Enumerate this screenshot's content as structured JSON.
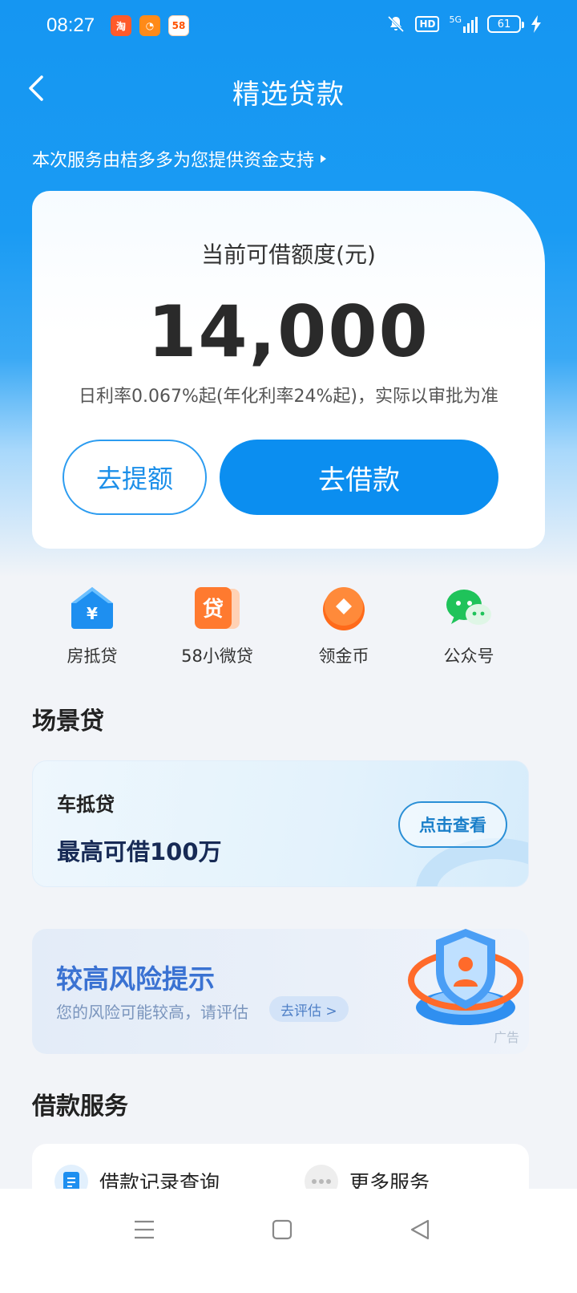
{
  "status_bar": {
    "time": "08:27",
    "app_icons": [
      "淘",
      "◔",
      "58"
    ],
    "hd": "HD",
    "network": "5G",
    "battery": "61"
  },
  "header": {
    "title": "精选贷款"
  },
  "provider_note": "本次服务由桔多多为您提供资金支持",
  "credit": {
    "label": "当前可借额度(元)",
    "amount": "14,000",
    "rate_note": "日利率0.067%起(年化利率24%起)，实际以审批为准",
    "raise_button": "去提额",
    "borrow_button": "去借款"
  },
  "quick_entries": [
    {
      "label": "房抵贷",
      "icon": "house-yuan-icon"
    },
    {
      "label": "58小微贷",
      "icon": "loan-tag-icon"
    },
    {
      "label": "领金币",
      "icon": "coin-icon"
    },
    {
      "label": "公众号",
      "icon": "wechat-icon"
    }
  ],
  "scene_section": {
    "title": "场景贷",
    "card": {
      "name": "车抵贷",
      "amount": "最高可借100万",
      "button": "点击查看"
    }
  },
  "risk_banner": {
    "title": "较高风险提示",
    "subtitle": "您的风险可能较高，请评估",
    "button": "去评估 >",
    "ad_tag": "广告"
  },
  "services_section": {
    "title": "借款服务",
    "items": [
      {
        "label": "借款记录查询",
        "icon": "document-icon"
      },
      {
        "label": "更多服务",
        "icon": "more-dots-icon"
      }
    ]
  },
  "colors": {
    "primary": "#0b8ef0",
    "hero": "#1596f2",
    "risk_title": "#3a72d2"
  }
}
